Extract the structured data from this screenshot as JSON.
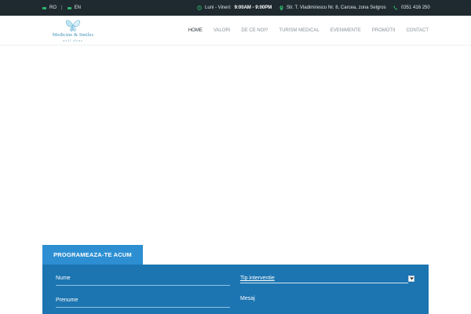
{
  "topbar": {
    "lang_ro": "RO",
    "lang_sep": "|",
    "lang_en": "EN",
    "hours_prefix": "Luni - Vineri:",
    "hours_value": "9:00AM - 9:00PM",
    "address": "Str. T. Vladimirescu Nr. 8, Carcea, zona Selgros",
    "phone": "0351 416 250"
  },
  "logo": {
    "name": "Medicine & Smiles",
    "tagline": "well done"
  },
  "menu": {
    "items": [
      "HOME",
      "VALORI",
      "DE CE NOI?",
      "TURISM MEDICAL",
      "EVENIMENTE",
      "PROMOTII",
      "CONTACT"
    ]
  },
  "form": {
    "tab_label": "PROGRAMEAZA-TE ACUM",
    "nume": "Nume",
    "prenume": "Prenume",
    "tip_interventie": "Tip interventie",
    "mesaj": "Mesaj"
  },
  "colors": {
    "topbar_bg": "#1f2a30",
    "accent_green": "#2fb36b",
    "tab_blue": "#2d8fd2",
    "panel_blue": "#1c75b1",
    "brand_blue": "#3e8fb7"
  }
}
